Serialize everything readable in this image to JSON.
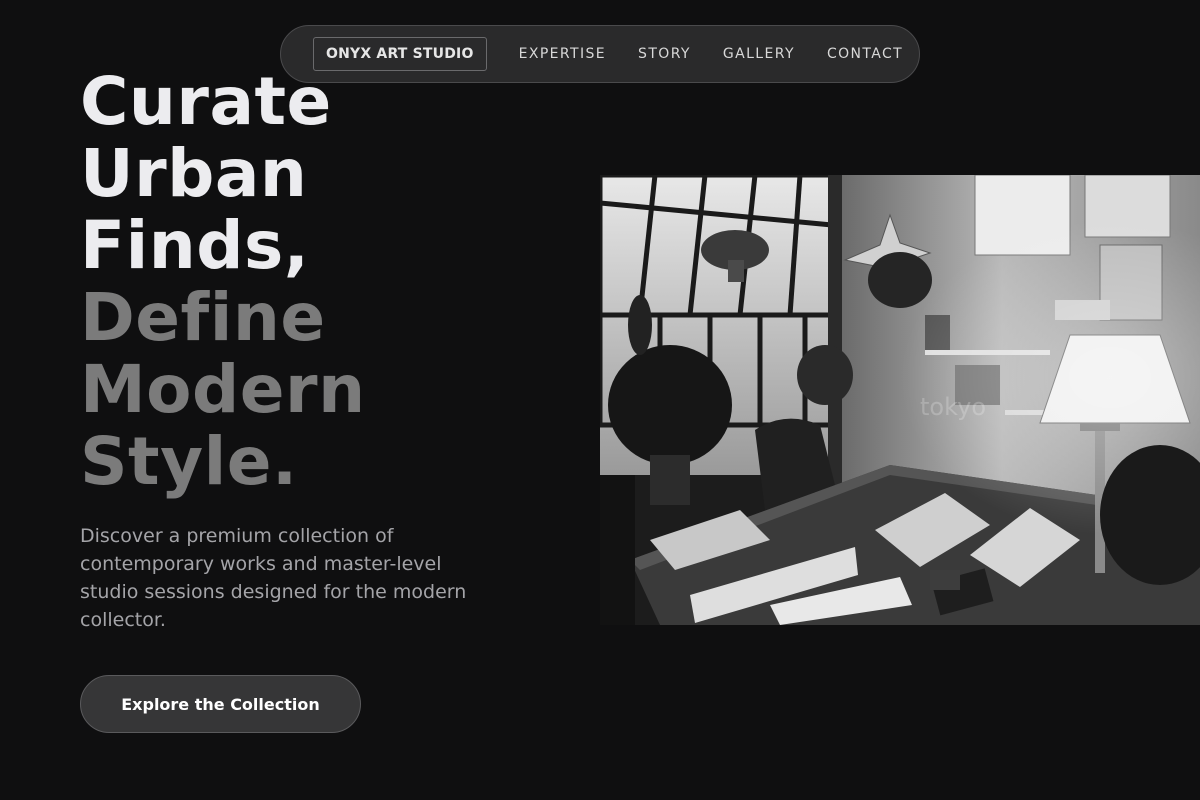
{
  "nav": {
    "brand": "ONYX ART STUDIO",
    "links": [
      "EXPERTISE",
      "STORY",
      "GALLERY",
      "CONTACT"
    ]
  },
  "hero": {
    "headline_light": [
      "Curate",
      "Urban",
      "Finds,"
    ],
    "headline_muted": [
      "Define",
      "Modern",
      "Style."
    ],
    "description": "Discover a premium collection of contemporary works and master-level studio sessions designed for the modern collector.",
    "cta_label": "Explore the Collection"
  },
  "photo": {
    "watermark": "tokyo"
  },
  "colors": {
    "background": "#0f0f10",
    "headline_light": "#ececef",
    "headline_muted": "#7b7b7b",
    "body_text": "#a4a4a8",
    "nav_background": "#2a2a2b",
    "cta_background": "#363637"
  }
}
